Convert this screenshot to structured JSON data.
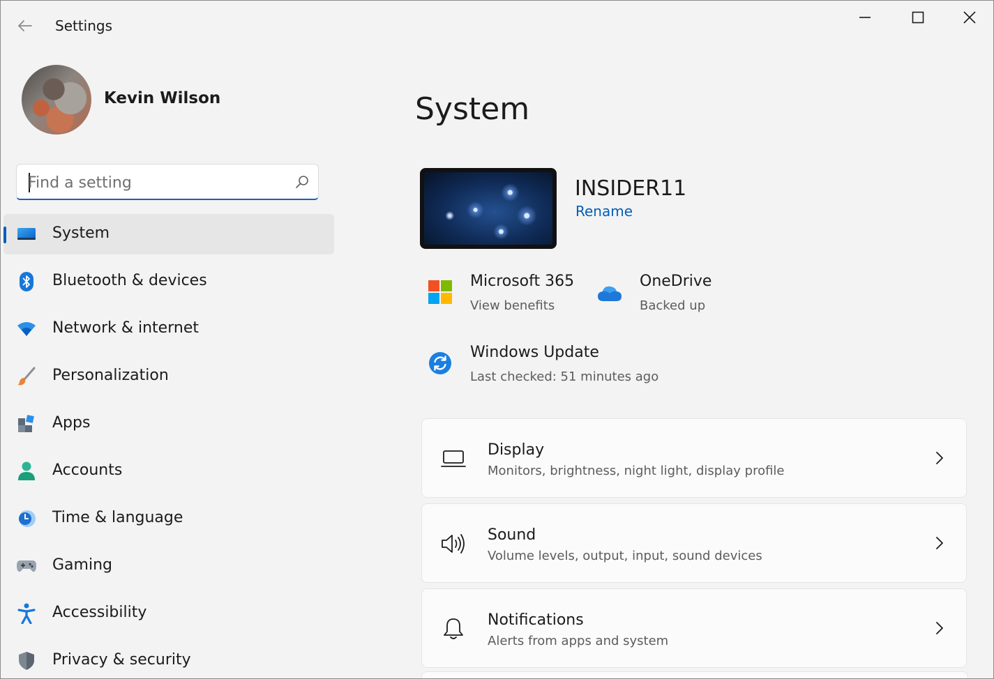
{
  "window": {
    "app_title": "Settings"
  },
  "profile": {
    "name": "Kevin Wilson"
  },
  "search": {
    "placeholder": "Find a setting",
    "value": ""
  },
  "sidebar": {
    "items": [
      {
        "label": "System",
        "icon": "monitor-icon",
        "active": true
      },
      {
        "label": "Bluetooth & devices",
        "icon": "bluetooth-icon",
        "active": false
      },
      {
        "label": "Network & internet",
        "icon": "wifi-icon",
        "active": false
      },
      {
        "label": "Personalization",
        "icon": "paintbrush-icon",
        "active": false
      },
      {
        "label": "Apps",
        "icon": "apps-icon",
        "active": false
      },
      {
        "label": "Accounts",
        "icon": "person-icon",
        "active": false
      },
      {
        "label": "Time & language",
        "icon": "clock-globe-icon",
        "active": false
      },
      {
        "label": "Gaming",
        "icon": "gamepad-icon",
        "active": false
      },
      {
        "label": "Accessibility",
        "icon": "accessibility-icon",
        "active": false
      },
      {
        "label": "Privacy & security",
        "icon": "shield-icon",
        "active": false
      }
    ]
  },
  "main": {
    "title": "System",
    "device": {
      "name": "INSIDER11",
      "rename_label": "Rename"
    },
    "tiles": {
      "m365": {
        "title": "Microsoft 365",
        "subtitle": "View benefits"
      },
      "onedrive": {
        "title": "OneDrive",
        "subtitle": "Backed up"
      },
      "update": {
        "title": "Windows Update",
        "subtitle": "Last checked: 51 minutes ago"
      }
    },
    "cards": [
      {
        "title": "Display",
        "subtitle": "Monitors, brightness, night light, display profile",
        "icon": "laptop-icon"
      },
      {
        "title": "Sound",
        "subtitle": "Volume levels, output, input, sound devices",
        "icon": "speaker-icon"
      },
      {
        "title": "Notifications",
        "subtitle": "Alerts from apps and system",
        "icon": "bell-icon"
      }
    ]
  },
  "colors": {
    "accent": "#005fb8",
    "background": "#f3f3f3",
    "card": "#fbfbfb"
  }
}
